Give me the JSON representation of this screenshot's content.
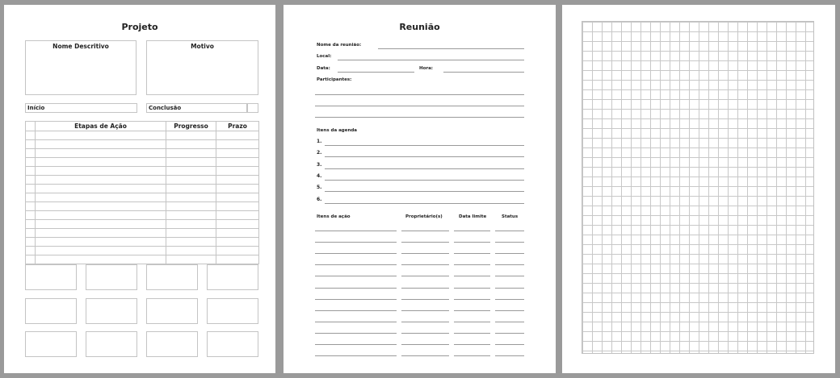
{
  "projeto": {
    "title": "Projeto",
    "nome_descritivo": "Nome Descritivo",
    "motivo": "Motivo",
    "inicio": "Início",
    "conclusao": "Conclusão",
    "table_headers": [
      "Etapas de Ação",
      "Progresso",
      "Prazo"
    ],
    "table_rows": 15
  },
  "reuniao": {
    "title": "Reunião",
    "nome_label": "Nome da reunião:",
    "local_label": "Local:",
    "data_label": "Data:",
    "hora_label": "Hora:",
    "participantes_label": "Participantes:",
    "itens_agenda_label": "Itens da agenda",
    "agenda_numbers": [
      "1.",
      "2.",
      "3.",
      "4.",
      "5.",
      "6."
    ],
    "itens_acao_header": "Itens de ação",
    "proprietarios_header": "Proprietário(s)",
    "data_limite_header": "Data limite",
    "status_header": "Status",
    "action_rows": 12
  },
  "grid_page": {
    "type": "graph-paper"
  },
  "colors": {
    "background": "#9a9a9a",
    "page": "#ffffff",
    "line": "#c4c4c4"
  }
}
